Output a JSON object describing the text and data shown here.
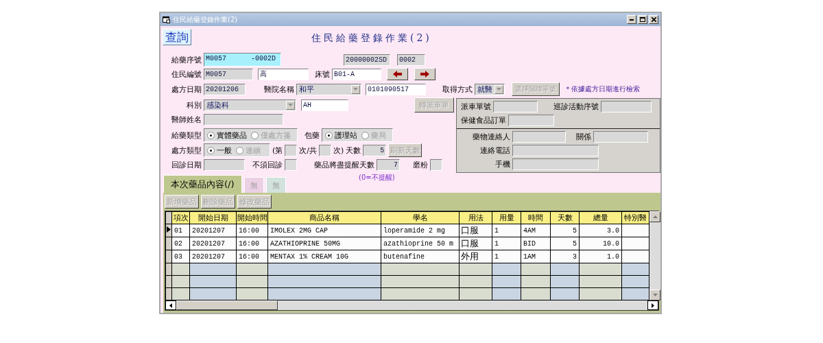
{
  "window": {
    "title": "住民給藥登錄作業(2)"
  },
  "query_button": {
    "label": "查詢"
  },
  "form_title": "住民給藥登錄作業(2)",
  "header_rows": [
    {
      "items": [
        {
          "kind": "label",
          "text": "給藥序號"
        },
        {
          "kind": "field",
          "value": "M0057      -0002D",
          "disabled": false,
          "focused": true
        },
        {
          "kind": "field",
          "value": "20000002SD",
          "disabled": true
        },
        {
          "kind": "field",
          "value": "0002",
          "disabled": true
        }
      ]
    },
    {
      "items": [
        {
          "kind": "label",
          "text": "住民編號"
        },
        {
          "kind": "field",
          "value": "M0057",
          "disabled": true
        },
        {
          "kind": "field",
          "value": "高",
          "disabled": false
        },
        {
          "kind": "label",
          "text": "床號"
        },
        {
          "kind": "field",
          "value": "B01-A",
          "disabled": false
        },
        {
          "kind": "prev-button"
        },
        {
          "kind": "next-button"
        }
      ]
    },
    {
      "items": [
        {
          "kind": "label",
          "text": "處方日期"
        },
        {
          "kind": "field",
          "value": "20201206",
          "disabled": true
        },
        {
          "kind": "label",
          "text": "醫院名稱"
        },
        {
          "kind": "combo",
          "value": "和平",
          "disabled": true
        },
        {
          "kind": "field",
          "value": "0101090517",
          "disabled": false
        },
        {
          "kind": "label",
          "text": "取得方式"
        },
        {
          "kind": "combo",
          "value": "就醫",
          "disabled": true
        },
        {
          "kind": "button",
          "label": "選擇關聯單號",
          "disabled": true
        },
        {
          "kind": "note",
          "text": "＊依據處方日期進行檢索"
        }
      ]
    }
  ],
  "left_rows": [
    {
      "items": [
        {
          "kind": "label",
          "text": "科別"
        },
        {
          "kind": "combo",
          "value": "感染科",
          "disabled": true
        },
        {
          "kind": "field",
          "value": "AH",
          "disabled": false
        },
        {
          "kind": "button",
          "label": "轉派車單",
          "disabled": true
        }
      ]
    },
    {
      "items": [
        {
          "kind": "label",
          "text": "醫師姓名"
        },
        {
          "kind": "field",
          "disabled": true
        }
      ]
    },
    {
      "items": [
        {
          "kind": "label",
          "text": "給藥類型"
        },
        {
          "kind": "radio-group",
          "options": [
            {
              "label": "實體藥品",
              "selected": true
            },
            {
              "label": "僅處方箋",
              "selected": false
            }
          ]
        },
        {
          "kind": "label",
          "text": "包藥"
        },
        {
          "kind": "radio-group",
          "options": [
            {
              "label": "護理站",
              "selected": true
            },
            {
              "label": "藥局",
              "selected": false
            }
          ]
        }
      ]
    },
    {
      "items": [
        {
          "kind": "label",
          "text": "處方類型"
        },
        {
          "kind": "radio-group",
          "options": [
            {
              "label": "一般",
              "selected": true
            },
            {
              "label": "連續",
              "selected": false
            }
          ]
        },
        {
          "kind": "label",
          "text": "(第"
        },
        {
          "kind": "field",
          "disabled": true
        },
        {
          "kind": "label",
          "text": "次/共"
        },
        {
          "kind": "field",
          "disabled": true
        },
        {
          "kind": "label",
          "text": "次)"
        },
        {
          "kind": "label",
          "text": "天數"
        },
        {
          "kind": "field",
          "value": "5",
          "disabled": true
        },
        {
          "kind": "button",
          "label": "刷新天數",
          "disabled": true
        }
      ]
    },
    {
      "items": [
        {
          "kind": "label",
          "text": "回診日期"
        },
        {
          "kind": "field",
          "disabled": true
        },
        {
          "kind": "label",
          "text": "不須回診"
        },
        {
          "kind": "checkbox",
          "checked": false
        },
        {
          "kind": "label",
          "text": "藥品將盡提醒天數"
        },
        {
          "kind": "field",
          "value": "7",
          "disabled": true
        },
        {
          "kind": "label",
          "text": "磨粉"
        },
        {
          "kind": "checkbox",
          "checked": false
        }
      ]
    }
  ],
  "hint": "(0=不提醒)",
  "panel": {
    "sections": [
      {
        "rows": [
          {
            "items": [
              {
                "kind": "label",
                "text": "派車單號"
              },
              {
                "kind": "field",
                "disabled": true
              },
              {
                "kind": "label",
                "text": "巡診活動序號"
              },
              {
                "kind": "field",
                "disabled": true
              }
            ]
          },
          {
            "items": [
              {
                "kind": "label",
                "text": "保健食品訂單"
              },
              {
                "kind": "field",
                "disabled": true
              }
            ]
          }
        ]
      },
      {
        "rows": [
          {
            "items": [
              {
                "kind": "label",
                "text": "藥物連絡人"
              },
              {
                "kind": "field",
                "disabled": true
              },
              {
                "kind": "label",
                "text": "關係"
              },
              {
                "kind": "field",
                "disabled": true
              }
            ]
          },
          {
            "items": [
              {
                "kind": "label",
                "text": "連絡電話"
              },
              {
                "kind": "field",
                "disabled": true
              }
            ]
          },
          {
            "items": [
              {
                "kind": "label",
                "text": "手機"
              },
              {
                "kind": "field",
                "disabled": true
              }
            ]
          }
        ]
      }
    ]
  },
  "tabs": [
    {
      "label": "本次藥品內容(/)",
      "selected": true,
      "color": "#bec88e"
    },
    {
      "label": "無",
      "selected": false,
      "color": "#ecd0e4"
    },
    {
      "label": "無",
      "selected": false,
      "color": "#d2e2dc"
    }
  ],
  "toolbar": [
    {
      "label": "新增藥品",
      "disabled": true
    },
    {
      "label": "刪除藥品",
      "disabled": true
    },
    {
      "label": "修改藥品",
      "disabled": true
    }
  ],
  "table": {
    "columns": [
      "項次",
      "開始日期",
      "開始時間",
      "商品名稱",
      "學名",
      "用法",
      "用量",
      "時間",
      "天數",
      "總量",
      "特別醫"
    ],
    "rows": [
      {
        "selected": true,
        "cells": [
          "01",
          "20201207",
          "16:00",
          "IMOLEX 2MG CAP",
          "loperamide 2 mg",
          "口服",
          "1",
          "4AM",
          "5",
          "3.0"
        ]
      },
      {
        "selected": false,
        "cells": [
          "02",
          "20201207",
          "16:00",
          "AZATHIOPRINE 50MG",
          "azathioprine 50 m",
          "口服",
          "1",
          "BID",
          "5",
          "10.0"
        ]
      },
      {
        "selected": false,
        "cells": [
          "03",
          "20201207",
          "16:00",
          "MENTAX 1% CREAM 10G",
          "butenafine",
          "外用",
          "1",
          "1AM",
          "3",
          "1.0"
        ]
      }
    ]
  }
}
